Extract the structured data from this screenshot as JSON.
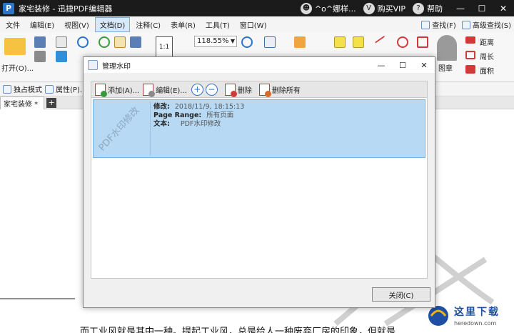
{
  "app": {
    "title": "家宅装修 - 迅捷PDF编辑器",
    "logo_letter": "P",
    "user_name": "^o^娜样...",
    "vip_label": "购买VIP",
    "help_label": "帮助"
  },
  "menu": {
    "items": [
      "文件",
      "编辑(E)",
      "视图(V)",
      "文档(D)",
      "注释(C)",
      "表单(R)",
      "工具(T)",
      "窗口(W)"
    ],
    "active_index": 3,
    "find_label": "查找(F)",
    "advanced_find_label": "高级查找(S)"
  },
  "ribbon": {
    "open_label": "打开(O)...",
    "page_badge": "1:1",
    "zoom_value": "118.55%",
    "distance_label": "距离",
    "perimeter_label": "周长",
    "area_label": "面积",
    "stamp_label": "图章"
  },
  "subbar": {
    "exclusive_mode": "独占模式",
    "properties": "属性(P)..."
  },
  "tabs": {
    "doc_tab": "家宅装修 *",
    "add_symbol": "+"
  },
  "dialog": {
    "title": "管理水印",
    "toolbar": {
      "add_label": "添加(A)...",
      "edit_label": "编辑(E)...",
      "zoom_in_symbol": "+",
      "zoom_out_symbol": "−",
      "delete_label": "删除",
      "delete_all_label": "删除所有"
    },
    "watermark": {
      "thumb_text": "PDF水印修改",
      "modified_label": "修改:",
      "modified_value": "2018/11/9, 18:15:13",
      "page_range_label": "Page Range:",
      "page_range_value": "所有页面",
      "text_label": "文本:",
      "text_value": "PDF水印修改"
    },
    "close_label": "关闭(C)"
  },
  "document": {
    "body_text": "而工业风就是其中一种。提起工业风，总是给人一种废弃厂房的印象，但就是"
  },
  "site_logo": {
    "name": "这里下载",
    "url_text": "heredown.com"
  },
  "colors": {
    "title_bar": "#1b1b1b",
    "selection": "#b7d9f3",
    "accent": "#2a74c9"
  }
}
